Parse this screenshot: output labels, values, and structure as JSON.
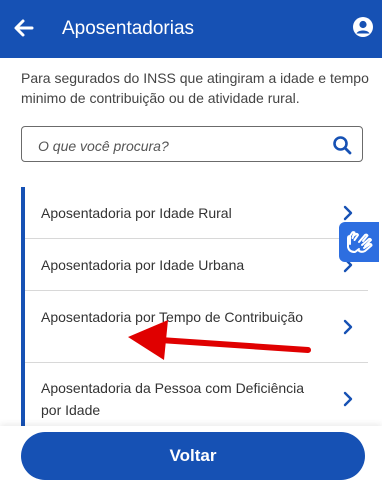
{
  "header": {
    "title": "Aposentadorias",
    "back_icon": "arrow-left-icon",
    "user_icon": "user-circle-icon"
  },
  "subtitle": "Para segurados do INSS que atingiram a idade e tempo minimo de contribuição ou de atividade rural.",
  "search": {
    "placeholder": "O que você procura?",
    "icon": "search-icon"
  },
  "list": {
    "items": [
      {
        "label": "Aposentadoria por Idade Rural"
      },
      {
        "label": "Aposentadoria por Idade Urbana"
      },
      {
        "label": "Aposentadoria por Tempo de Contribuição"
      },
      {
        "label": "Aposentadoria da Pessoa com Deficiência por Idade"
      }
    ]
  },
  "footer": {
    "back_button": "Voltar"
  },
  "colors": {
    "primary": "#1651b4",
    "accessibility": "#2d6ee0",
    "annotation_arrow": "#e00000"
  },
  "accessibility_icon": "sign-language-hands-icon"
}
